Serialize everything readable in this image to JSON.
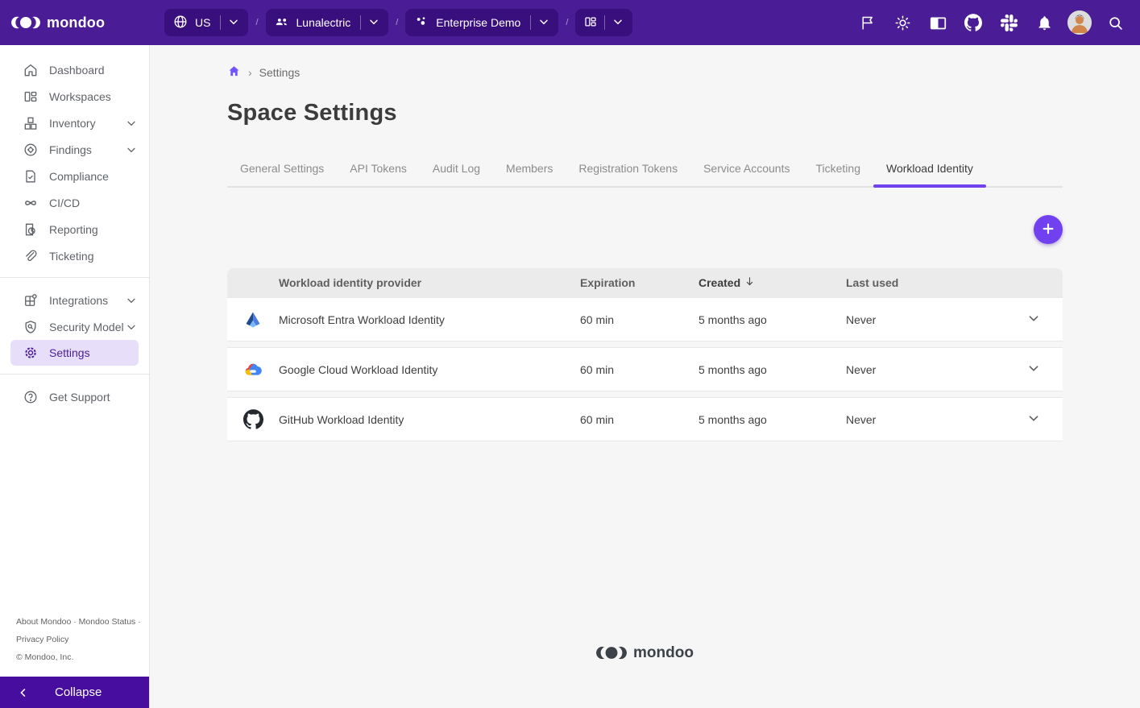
{
  "brand": {
    "name": "mondoo"
  },
  "header": {
    "separator": "/",
    "region": {
      "label": "US"
    },
    "organization": {
      "label": "Lunalectric"
    },
    "space": {
      "label": "Enterprise Demo"
    }
  },
  "breadcrumb": {
    "separator": "›",
    "current": "Settings"
  },
  "page": {
    "title": "Space Settings"
  },
  "tabs": {
    "active": "Workload Identity",
    "items": [
      "General Settings",
      "API Tokens",
      "Audit Log",
      "Members",
      "Registration Tokens",
      "Service Accounts",
      "Ticketing",
      "Workload Identity"
    ]
  },
  "sidebar": {
    "items": [
      {
        "label": "Dashboard"
      },
      {
        "label": "Workspaces"
      },
      {
        "label": "Inventory",
        "expandable": true
      },
      {
        "label": "Findings",
        "expandable": true
      },
      {
        "label": "Compliance"
      },
      {
        "label": "CI/CD"
      },
      {
        "label": "Reporting"
      },
      {
        "label": "Ticketing"
      },
      {
        "label": "Integrations",
        "expandable": true
      },
      {
        "label": "Security Model",
        "expandable": true
      },
      {
        "label": "Settings",
        "active": true
      }
    ],
    "support_label": "Get Support",
    "footer": {
      "links": [
        "About Mondoo",
        "Mondoo Status",
        "Privacy Policy"
      ],
      "separator": "·",
      "copyright": "© Mondoo, Inc."
    },
    "collapse_label": "Collapse"
  },
  "table": {
    "columns": [
      "Workload identity provider",
      "Expiration",
      "Created",
      "Last used"
    ],
    "sorted_by": "Created",
    "sort_direction": "desc",
    "rows": [
      {
        "icon": "microsoft-entra-icon",
        "provider": "Microsoft Entra Workload Identity",
        "expiration": "60 min",
        "created": "5 months ago",
        "last_used": "Never"
      },
      {
        "icon": "google-cloud-icon",
        "provider": "Google Cloud Workload Identity",
        "expiration": "60 min",
        "created": "5 months ago",
        "last_used": "Never"
      },
      {
        "icon": "github-icon",
        "provider": "GitHub Workload Identity",
        "expiration": "60 min",
        "created": "5 months ago",
        "last_used": "Never"
      }
    ]
  },
  "footer": {
    "brand": "mondoo"
  },
  "colors": {
    "header_bg": "#4A1D96",
    "pill_bg": "#390F7D",
    "accent": "#7141F0",
    "active_item_bg": "#E7DEF9",
    "active_item_text": "#4A1D96",
    "content_bg": "#F6F6F6",
    "table_header_bg": "#EBEBEB"
  }
}
